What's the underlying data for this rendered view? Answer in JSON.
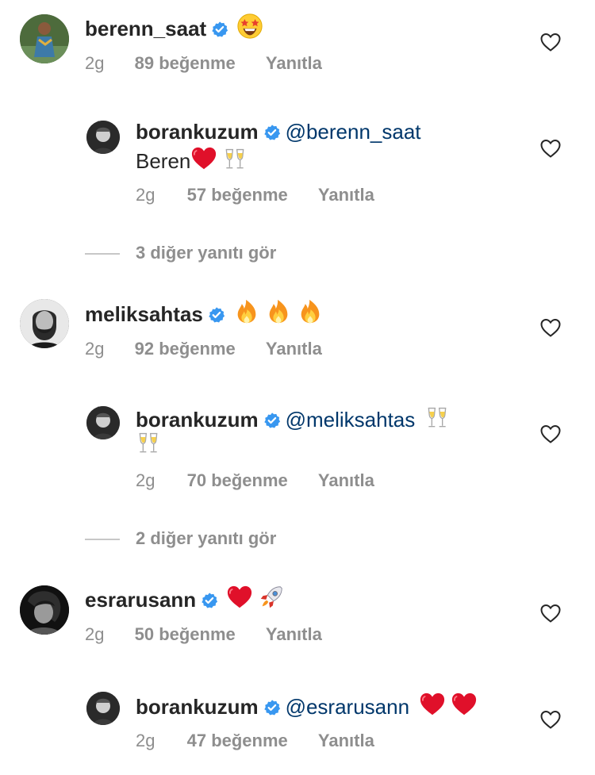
{
  "comments": [
    {
      "username": "berenn_saat",
      "text": "",
      "emojis": [
        "star-struck"
      ],
      "time": "2g",
      "likes": "89 beğenme",
      "reply": "Yanıtla",
      "replies": [
        {
          "username": "borankuzum",
          "mention": "@berenn_saat",
          "text": "Beren",
          "emojis": [
            "red-heart",
            "champagne-glasses"
          ],
          "time": "2g",
          "likes": "57 beğenme",
          "reply": "Yanıtla"
        }
      ],
      "view_more": "3 diğer yanıtı gör"
    },
    {
      "username": "meliksahtas",
      "text": "",
      "emojis": [
        "fire",
        "fire",
        "fire"
      ],
      "time": "2g",
      "likes": "92 beğenme",
      "reply": "Yanıtla",
      "replies": [
        {
          "username": "borankuzum",
          "mention": "@meliksahtas",
          "text": "",
          "emojis": [
            "champagne-glasses",
            "champagne-glasses"
          ],
          "time": "2g",
          "likes": "70 beğenme",
          "reply": "Yanıtla"
        }
      ],
      "view_more": "2 diğer yanıtı gör"
    },
    {
      "username": "esrarusann",
      "text": "",
      "emojis": [
        "red-heart",
        "rocket"
      ],
      "time": "2g",
      "likes": "50 beğenme",
      "reply": "Yanıtla",
      "replies": [
        {
          "username": "borankuzum",
          "mention": "@esrarusann",
          "text": "",
          "emojis": [
            "red-heart",
            "red-heart"
          ],
          "time": "2g",
          "likes": "47 beğenme",
          "reply": "Yanıtla"
        }
      ]
    }
  ],
  "colors": {
    "verified_badge": "#3897f0",
    "mention": "#00376b",
    "meta_text": "#8e8e8e",
    "primary_text": "#262626"
  }
}
